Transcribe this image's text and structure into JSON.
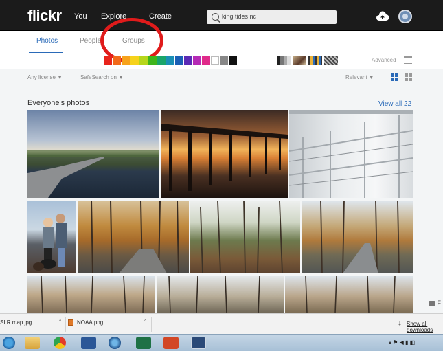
{
  "header": {
    "logo": "flickr",
    "nav": [
      "You",
      "Explore",
      "Create"
    ],
    "search_value": "king tides nc"
  },
  "subnav": {
    "tabs": [
      "Photos",
      "People",
      "Groups"
    ],
    "active_tab": "Photos"
  },
  "colors": {
    "swatches": [
      "#e8241b",
      "#f26a1b",
      "#f7a21b",
      "#f6d21b",
      "#b6d61b",
      "#3fb51b",
      "#1aa56a",
      "#1a8fb5",
      "#1a5fb5",
      "#5a2ab5",
      "#b52ab5",
      "#e02a8a",
      "#ffffff",
      "#888888",
      "#111111"
    ],
    "accent": "#2a6ab8",
    "annotation_circle": "#e01b1b"
  },
  "filters": {
    "license": "Any license ▼",
    "safesearch": "SafeSearch on ▼",
    "sort": "Relevant ▼",
    "advanced": "Advanced"
  },
  "main": {
    "section_title": "Everyone's photos",
    "view_all": "View all 22"
  },
  "side_partial": "F",
  "downloads": {
    "items": [
      "SLR map.jpg",
      "NOAA.png"
    ],
    "show_all": "Show all downloads"
  },
  "taskbar": {
    "apps": [
      "ie-icon",
      "explorer-folder-icon",
      "chrome-icon",
      "word-icon",
      "earth-icon",
      "excel-icon",
      "powerpoint-icon",
      "window-icon"
    ]
  }
}
